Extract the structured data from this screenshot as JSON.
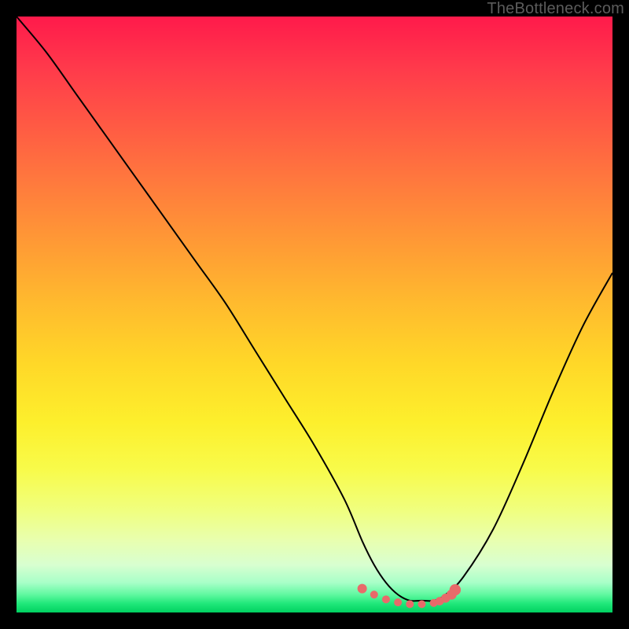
{
  "watermark": "TheBottleneck.com",
  "colors": {
    "curve": "#000000",
    "marker_fill": "#e86a6a",
    "marker_stroke": "#c94f4f"
  },
  "chart_data": {
    "type": "line",
    "title": "",
    "xlabel": "",
    "ylabel": "",
    "xlim": [
      0,
      100
    ],
    "ylim": [
      0,
      100
    ],
    "series": [
      {
        "name": "bottleneck-curve",
        "x": [
          0,
          5,
          10,
          15,
          20,
          25,
          30,
          35,
          40,
          45,
          50,
          55,
          58,
          60,
          62,
          64,
          66,
          68,
          70,
          72,
          75,
          80,
          85,
          90,
          95,
          100
        ],
        "values": [
          100,
          94,
          87,
          80,
          73,
          66,
          59,
          52,
          44,
          36,
          28,
          19,
          12,
          8,
          5,
          3,
          2,
          2,
          2,
          3,
          6,
          14,
          25,
          37,
          48,
          57
        ]
      }
    ],
    "markers": {
      "name": "optimal-range",
      "x": [
        58,
        60,
        62,
        64,
        66,
        68,
        70,
        71,
        72,
        73,
        73.6
      ],
      "values": [
        4.0,
        3.0,
        2.2,
        1.7,
        1.4,
        1.4,
        1.6,
        1.9,
        2.4,
        3.0,
        3.8
      ],
      "radius": [
        6,
        5,
        5,
        5,
        5,
        5,
        5,
        5.4,
        5.8,
        6.4,
        7.2
      ]
    }
  }
}
